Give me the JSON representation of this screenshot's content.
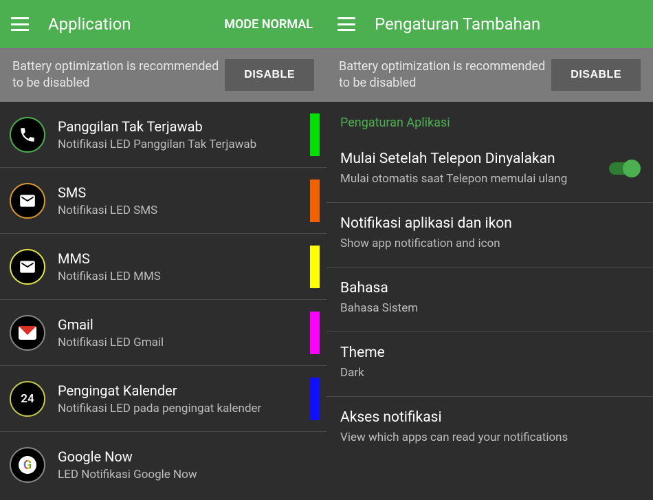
{
  "left": {
    "header": {
      "title": "Application",
      "mode": "MODE NORMAL"
    },
    "banner": {
      "text": "Battery optimization is recommended to be disabled",
      "button": "DISABLE"
    },
    "apps": [
      {
        "title": "Panggilan Tak Terjawab",
        "sub": "Notifikasi LED Panggilan Tak Terjawab",
        "color": "#00e000"
      },
      {
        "title": "SMS",
        "sub": "Notifikasi LED SMS",
        "color": "#f26000"
      },
      {
        "title": "MMS",
        "sub": "Notifikasi LED MMS",
        "color": "#ffff00"
      },
      {
        "title": "Gmail",
        "sub": "Notifikasi LED Gmail",
        "color": "#ff00ff"
      },
      {
        "title": "Pengingat Kalender",
        "sub": "Notifikasi LED pada pengingat kalender",
        "color": "#1010ff"
      },
      {
        "title": "Google Now",
        "sub": "LED Notifikasi Google Now",
        "color": ""
      }
    ]
  },
  "right": {
    "header": {
      "title": "Pengaturan Tambahan"
    },
    "banner": {
      "text": "Battery optimization is recommended to be disabled",
      "button": "DISABLE"
    },
    "section": "Pengaturan Aplikasi",
    "settings": [
      {
        "title": "Mulai Setelah Telepon Dinyalakan",
        "sub": "Mulai otomatis saat Telepon memulai ulang",
        "toggle": true
      },
      {
        "title": "Notifikasi aplikasi dan ikon",
        "sub": "Show app notification and icon"
      },
      {
        "title": "Bahasa",
        "sub": "Bahasa Sistem"
      },
      {
        "title": "Theme",
        "sub": "Dark"
      },
      {
        "title": "Akses notifikasi",
        "sub": "View which apps can read your notifications"
      }
    ]
  }
}
